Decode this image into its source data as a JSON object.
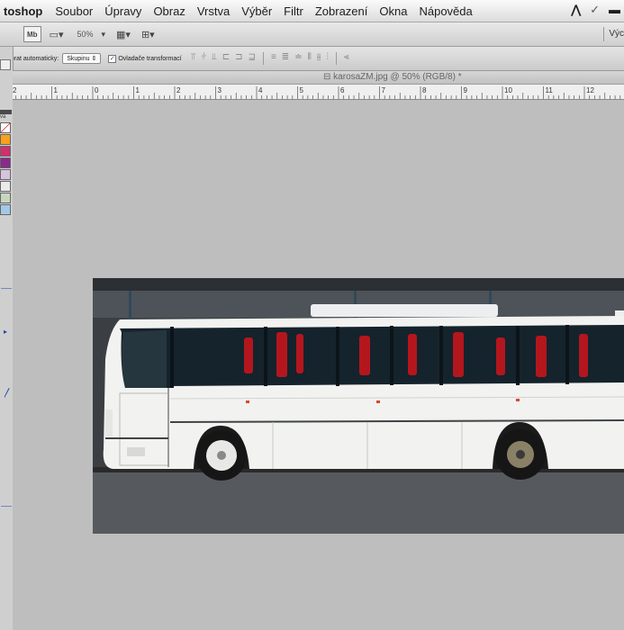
{
  "menubar": {
    "app": "toshop",
    "items": [
      "Soubor",
      "Úpravy",
      "Obraz",
      "Vrstva",
      "Výběr",
      "Filtr",
      "Zobrazení",
      "Okna",
      "Nápověda"
    ]
  },
  "appbar": {
    "mb_label": "Mb",
    "zoom": "50%",
    "workspace": "Výc"
  },
  "options": {
    "auto_select_label": "Vybrat automaticky:",
    "auto_select_value": "Skupinu",
    "transform_label": "Ovladače transformací",
    "transform_checked": true
  },
  "document": {
    "tab_title": "karosaZM.jpg @ 50% (RGB/8) *"
  },
  "ruler": {
    "labels": [
      "2",
      "1",
      "0",
      "1",
      "2",
      "3",
      "4",
      "5",
      "6",
      "7",
      "8",
      "9",
      "10",
      "11",
      "12"
    ]
  },
  "tools_panel": {
    "top_label": "va"
  },
  "colors": {
    "canvas_bg": "#bebebe",
    "photo_bg": "#3a3d40",
    "bus_body": "#f2f2f0",
    "seat_red": "#b4161e"
  }
}
